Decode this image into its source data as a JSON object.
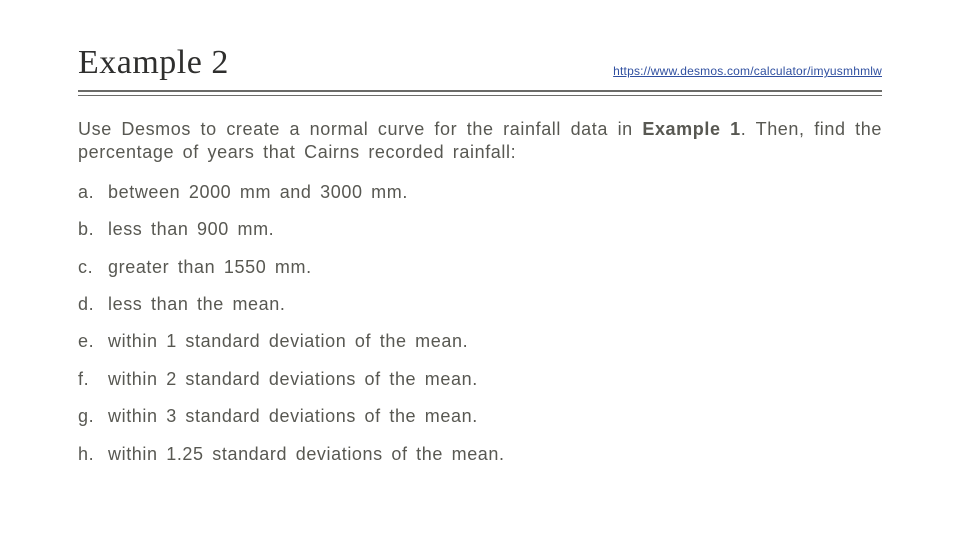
{
  "header": {
    "title": "Example 2",
    "link_text": "https://www.desmos.com/calculator/imyusmhmlw",
    "link_href": "https://www.desmos.com/calculator/imyusmhmlw"
  },
  "intro": {
    "part1": "Use Desmos to create a normal curve for the rainfall data in ",
    "bold": "Example 1",
    "part2": ". Then, find the percentage of years that Cairns recorded rainfall:"
  },
  "items": [
    {
      "marker": "a.",
      "text": "between 2000 mm and 3000 mm."
    },
    {
      "marker": "b.",
      "text": "less than 900 mm."
    },
    {
      "marker": "c.",
      "text": "greater than 1550 mm."
    },
    {
      "marker": "d.",
      "text": "less than the mean."
    },
    {
      "marker": "e.",
      "text": "within 1 standard deviation of the mean."
    },
    {
      "marker": "f.",
      "text": "within 2 standard deviations of the mean."
    },
    {
      "marker": "g.",
      "text": "within 3 standard deviations of the mean."
    },
    {
      "marker": "h.",
      "text": "within 1.25 standard deviations of the mean."
    }
  ]
}
